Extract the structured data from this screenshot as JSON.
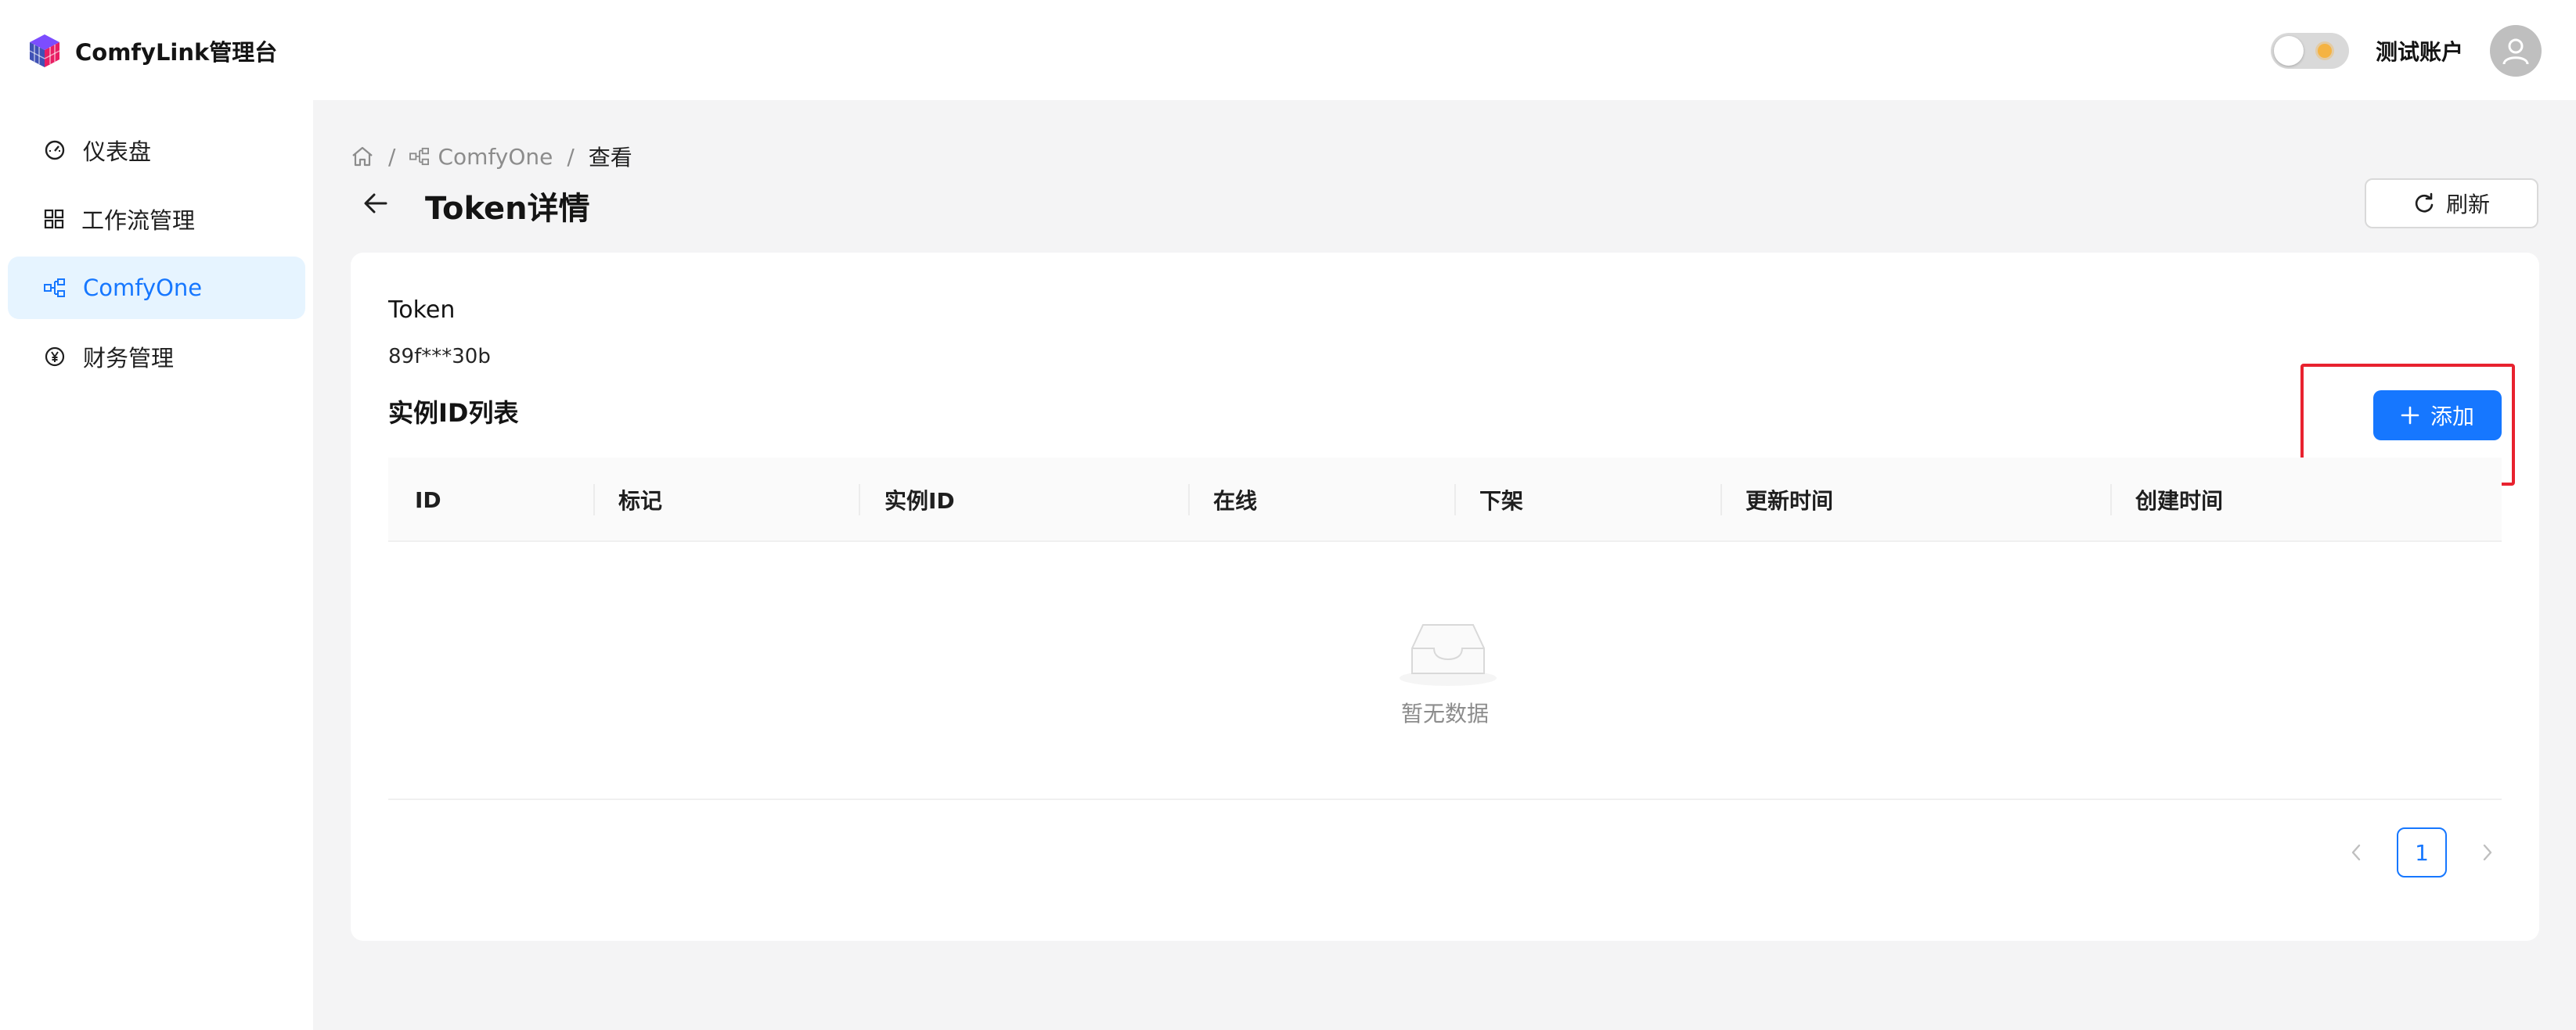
{
  "header": {
    "brand": "ComfyLink管理台",
    "account_name": "测试账户"
  },
  "sidebar": {
    "items": [
      {
        "label": "仪表盘",
        "icon": "dashboard-icon",
        "active": false
      },
      {
        "label": "工作流管理",
        "icon": "grid-icon",
        "active": false
      },
      {
        "label": "ComfyOne",
        "icon": "nodes-icon",
        "active": true
      },
      {
        "label": "财务管理",
        "icon": "yuan-icon",
        "active": false
      }
    ]
  },
  "breadcrumb": {
    "home_icon": "home-icon",
    "items": [
      "ComfyOne",
      "查看"
    ],
    "separator": "/"
  },
  "page": {
    "title": "Token详情",
    "refresh_label": "刷新"
  },
  "token": {
    "label": "Token",
    "value": "89f***30b"
  },
  "instance_list": {
    "title": "实例ID列表",
    "add_label": "添加",
    "columns": [
      "ID",
      "标记",
      "实例ID",
      "在线",
      "下架",
      "更新时间",
      "创建时间"
    ],
    "rows": [],
    "empty_text": "暂无数据"
  },
  "pagination": {
    "current_page": "1"
  },
  "colors": {
    "accent": "#1677ff",
    "active_bg": "#e6f4ff",
    "highlight": "#e8222f",
    "page_bg": "#f4f4f5"
  }
}
